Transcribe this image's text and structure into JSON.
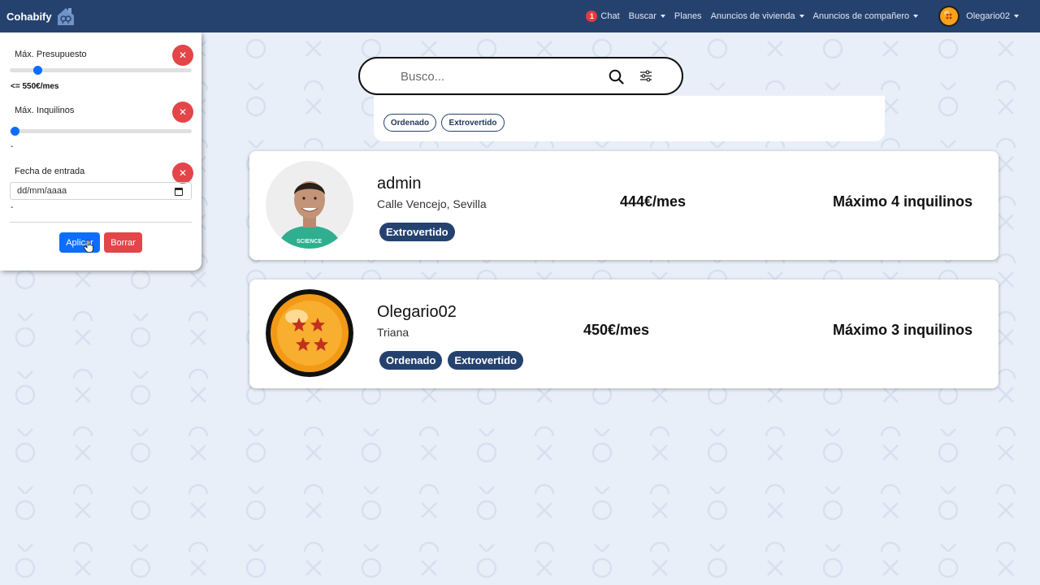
{
  "navbar": {
    "brand": "Cohabify",
    "chat_count": "1",
    "chat_label": "Chat",
    "buscar_label": "Buscar",
    "planes_label": "Planes",
    "anuncios_vivienda_label": "Anuncios de vivienda",
    "anuncios_companero_label": "Anuncios de compañero",
    "user_name": "Olegario02"
  },
  "filters": {
    "presupuesto": {
      "label": "Máx. Presupuesto",
      "value_text": "<= 550€/mes",
      "slider_level": 0.13
    },
    "inquilinos": {
      "label": "Máx. Inquilinos",
      "value_text": "-",
      "slider_level": 0.0
    },
    "fecha": {
      "label": "Fecha de entrada",
      "placeholder": "dd/mm/aaaa",
      "value_text": "-"
    },
    "clear_icon": "close-icon",
    "apply_label": "Aplicar",
    "clear_label": "Borrar"
  },
  "search": {
    "placeholder": "Busco...",
    "search_icon": "search-icon",
    "filters_icon": "sliders-icon"
  },
  "active_tags": [
    "Ordenado",
    "Extrovertido"
  ],
  "results": [
    {
      "name": "admin",
      "address": "Calle Vencejo, Sevilla",
      "tags": [
        "Extrovertido"
      ],
      "price": "444€/mes",
      "tenants": "Máximo 4 inquilinos",
      "photo": "person-photo"
    },
    {
      "name": "Olegario02",
      "address": "Triana",
      "tags": [
        "Ordenado",
        "Extrovertido"
      ],
      "price": "450€/mes",
      "tenants": "Máximo 3 inquilinos",
      "photo": "dragon-ball-avatar"
    }
  ],
  "colors": {
    "navbar": "#25426f",
    "accent_blue": "#0d6efd",
    "danger_red": "#e34548",
    "tag_bg": "#25426f",
    "page_bg": "#e9eff9"
  }
}
